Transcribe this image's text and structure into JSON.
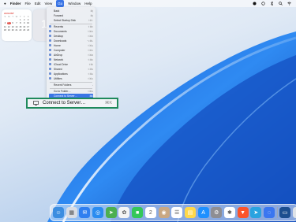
{
  "menubar": {
    "app_name": "Finder",
    "items": [
      "File",
      "Edit",
      "View",
      "Go",
      "Window",
      "Help"
    ],
    "active_item": "Go",
    "right_icons": [
      "control-center-icon",
      "airdrop-icon",
      "bluetooth-icon",
      "search-icon",
      "wifi-icon"
    ]
  },
  "calendar_widget": {
    "month": "AUGUST",
    "weekdays": [
      "S",
      "M",
      "T",
      "W",
      "T",
      "F",
      "S"
    ],
    "days": [
      "",
      "",
      "",
      "",
      "1",
      "2",
      "3",
      "4",
      "5",
      "6",
      "7",
      "8",
      "9",
      "10",
      "11",
      "12",
      "13",
      "14",
      "15",
      "16",
      "17",
      "18",
      "19",
      "20",
      "21",
      "22",
      "23",
      "24",
      "25",
      "26",
      "27",
      "28",
      "29",
      "30",
      "31"
    ],
    "today": "5"
  },
  "clock_widget": {
    "text": "1"
  },
  "go_menu": {
    "items": [
      {
        "label": "Back",
        "shortcut": "⌘["
      },
      {
        "label": "Forward",
        "shortcut": "⌘]"
      },
      {
        "label": "Select Startup Disk",
        "shortcut": "⇧⌘↑"
      },
      {
        "label": "Recents",
        "shortcut": "⇧⌘F"
      },
      {
        "label": "Documents",
        "shortcut": "⇧⌘O"
      },
      {
        "label": "Desktop",
        "shortcut": "⇧⌘D"
      },
      {
        "label": "Downloads",
        "shortcut": "⌥⌘L"
      },
      {
        "label": "Home",
        "shortcut": "⇧⌘H"
      },
      {
        "label": "Computer",
        "shortcut": "⇧⌘C"
      },
      {
        "label": "AirDrop",
        "shortcut": "⇧⌘R"
      },
      {
        "label": "Network",
        "shortcut": "⇧⌘K"
      },
      {
        "label": "iCloud Drive",
        "shortcut": "⇧⌘I"
      },
      {
        "label": "Shared",
        "shortcut": "⇧⌘S"
      },
      {
        "label": "Applications",
        "shortcut": "⇧⌘A"
      },
      {
        "label": "Utilities",
        "shortcut": "⇧⌘U"
      },
      {
        "label": "Recent Folders",
        "shortcut": "›"
      },
      {
        "label": "Go to Folder…",
        "shortcut": "⇧⌘G"
      },
      {
        "label": "Connect to Server…",
        "shortcut": "⌘K"
      }
    ]
  },
  "zoom_callout": {
    "label": "Connect to Server…",
    "shortcut": "⌘K",
    "border_color": "#1f8a5c"
  },
  "dock": {
    "apps": [
      {
        "name": "finder-icon",
        "color": "#3b8de0",
        "glyph": "☺"
      },
      {
        "name": "launchpad-icon",
        "color": "#d9dde4",
        "glyph": "▦"
      },
      {
        "name": "mail-icon",
        "color": "#2f7ff0",
        "glyph": "✉"
      },
      {
        "name": "safari-icon",
        "color": "#2a8cf0",
        "glyph": "◎"
      },
      {
        "name": "maps-icon",
        "color": "#4caf50",
        "glyph": "➤"
      },
      {
        "name": "photos-icon",
        "color": "#f4f4f4",
        "glyph": "✿"
      },
      {
        "name": "facetime-icon",
        "color": "#34c759",
        "glyph": "■"
      },
      {
        "name": "calendar-icon",
        "color": "#ffffff",
        "glyph": "2"
      },
      {
        "name": "contacts-icon",
        "color": "#c9a883",
        "glyph": "◉"
      },
      {
        "name": "reminders-icon",
        "color": "#ffffff",
        "glyph": "☰"
      },
      {
        "name": "notes-icon",
        "color": "#ffd84a",
        "glyph": "▤"
      },
      {
        "name": "appstore-icon",
        "color": "#1e90ff",
        "glyph": "A"
      },
      {
        "name": "system-settings-icon",
        "color": "#8e8e93",
        "glyph": "⚙"
      },
      {
        "name": "slack-icon",
        "color": "#ffffff",
        "glyph": "✱"
      },
      {
        "name": "brave-icon",
        "color": "#fb542b",
        "glyph": "▼"
      },
      {
        "name": "telegram-icon",
        "color": "#2aa3e0",
        "glyph": "➤"
      },
      {
        "name": "signal-icon",
        "color": "#3a76f0",
        "glyph": "◌"
      },
      {
        "name": "screen-sharing-icon",
        "color": "#1c4e8f",
        "glyph": "▭"
      },
      {
        "name": "trash-icon",
        "color": "#dfe3e8",
        "glyph": "▥"
      }
    ]
  }
}
